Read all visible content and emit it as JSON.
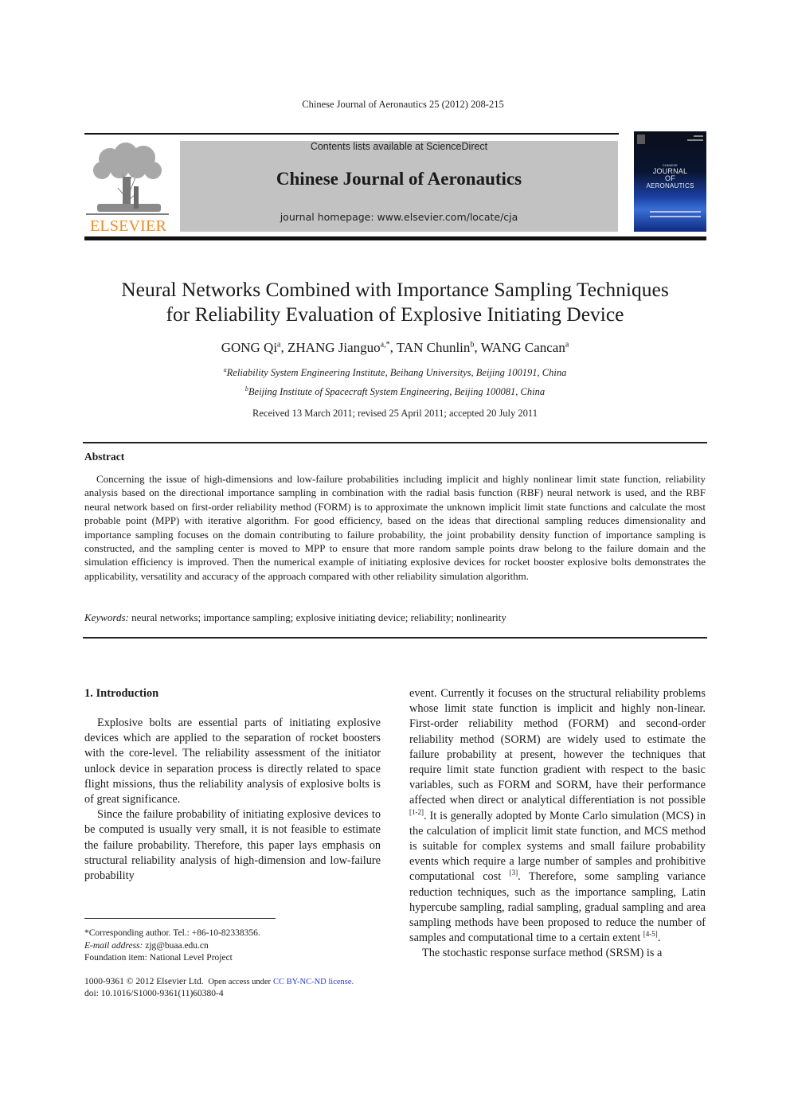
{
  "running_head": "Chinese Journal of Aeronautics 25 (2012) 208-215",
  "header": {
    "publisher_logo_text": "ELSEVIER",
    "contents_line": "Contents lists available at ScienceDirect",
    "journal_title": "Chinese Journal of Aeronautics",
    "homepage_line": "journal homepage: www.elsevier.com/locate/cja",
    "cover": {
      "top_word": "CHINESE",
      "line1": "JOURNAL",
      "line2": "OF",
      "line3": "AERONAUTICS",
      "colors": {
        "dark": "#0a1430",
        "accent_blue": "#3a6fd8"
      }
    },
    "colors": {
      "banner_bg": "#c2c2c2",
      "logo_orange": "#f08a24"
    }
  },
  "article": {
    "title_line1": "Neural Networks Combined with Importance Sampling Techniques",
    "title_line2": "for Reliability Evaluation of Explosive Initiating Device",
    "authors": [
      {
        "name": "GONG Qi",
        "sup": "a"
      },
      {
        "name": "ZHANG Jianguo",
        "sup": "a,*"
      },
      {
        "name": "TAN Chunlin",
        "sup": "b"
      },
      {
        "name": "WANG Cancan",
        "sup": "a"
      }
    ],
    "affiliations": [
      {
        "sup": "a",
        "text": "Reliability System Engineering Institute, Beihang Universitys, Beijing  100191, China"
      },
      {
        "sup": "b",
        "text": "Beijing Institute of Spacecraft System Engineering, Beijing  100081, China"
      }
    ],
    "received": "Received 13 March 2011; revised 25 April 2011; accepted 20 July 2011",
    "abstract_heading": "Abstract",
    "abstract": "Concerning the issue of high-dimensions and low-failure probabilities including implicit and highly nonlinear limit state function, reliability analysis based on the directional importance sampling in combination with the radial basis function (RBF) neural network is used, and the RBF neural network based on first-order reliability method (FORM) is to approximate the unknown implicit limit state functions and calculate the most probable point (MPP) with iterative algorithm. For good efficiency, based on the ideas that directional sampling reduces dimensionality and importance sampling focuses on the domain contributing to failure probability, the joint probability density function of importance sampling is constructed, and the sampling center is moved to MPP to ensure that more random sample points draw belong to the failure domain and the simulation efficiency is improved. Then the numerical example of initiating explosive devices for rocket booster explosive bolts demonstrates the applicability, versatility and accuracy of the approach compared with other reliability simulation algorithm.",
    "keywords_label": "Keywords:",
    "keywords": "neural networks; importance sampling; explosive initiating device; reliability; nonlinearity"
  },
  "body": {
    "section1_heading": "1. Introduction",
    "left_paragraphs": [
      "Explosive bolts are essential parts of initiating explosive devices which are applied to the separation of rocket boosters with the core-level. The reliability assessment of the initiator unlock device in separation process is directly related to space flight missions, thus the reliability analysis of explosive bolts is of great significance.",
      "Since the failure probability of initiating explosive devices to be computed is usually very small, it is not feasible to estimate the failure probability. Therefore, this paper lays emphasis on structural reliability analysis of high-dimension and low-failure probability"
    ],
    "right_para1_a": "event. Currently it focuses on the structural reliability problems whose limit state function is implicit and highly non-linear. First-order reliability method (FORM) and second-order reliability method (SORM) are widely used to estimate the failure probability at present, however the techniques that require limit state function gradient with respect to the basic variables, such as FORM and SORM, have their performance affected when direct or analytical differentiation is not possible ",
    "ref1": "[1-2]",
    "right_para1_b": ". It is generally adopted by Monte Carlo simulation (MCS) in the calculation of implicit limit state function, and MCS method is suitable for complex systems and small failure probability events which require a large number of samples and prohibitive computational cost ",
    "ref2": "[3]",
    "right_para1_c": ". Therefore, some sampling variance reduction techniques, such as the importance sampling, Latin hypercube sampling, radial sampling, gradual sampling and area sampling methods have been proposed to reduce the number of samples and computational time to a certain extent ",
    "ref3": "[4-5]",
    "right_para1_d": ".",
    "right_para2": "The stochastic response surface method (SRSM) is a"
  },
  "footnotes": {
    "corresponding": "*Corresponding author. Tel.: +86-10-82338356.",
    "email_label": "E-mail address:",
    "email": "zjg@buaa.edu.cn",
    "foundation": "Foundation item: National Level Project",
    "copyright": "1000-9361 © 2012 Elsevier Ltd.",
    "open_access": "Open access under",
    "license_link": "CC BY-NC-ND license.",
    "doi": "doi: 10.1016/S1000-9361(11)60380-4"
  }
}
